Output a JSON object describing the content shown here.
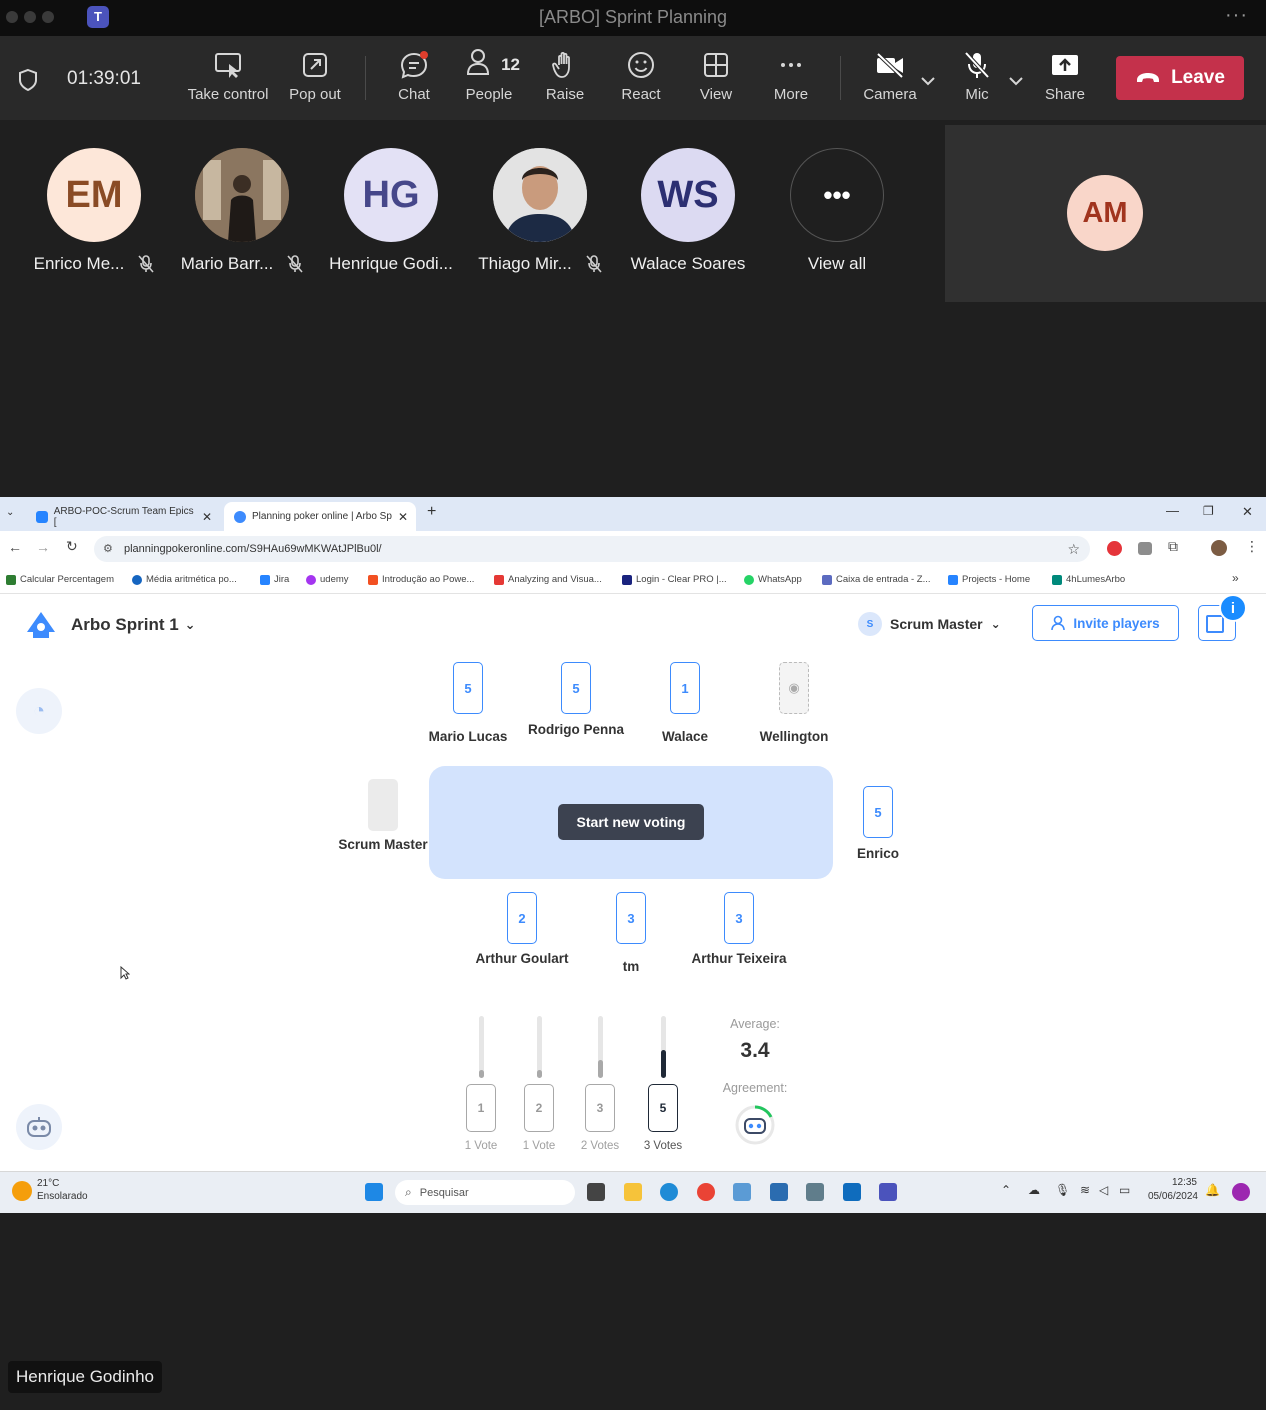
{
  "window": {
    "title": "[ARBO] Sprint Planning"
  },
  "toolbar": {
    "timer": "01:39:01",
    "take_control": "Take control",
    "pop_out": "Pop out",
    "chat": "Chat",
    "people": "People",
    "people_count": "12",
    "raise": "Raise",
    "react": "React",
    "view": "View",
    "more": "More",
    "camera": "Camera",
    "mic": "Mic",
    "share": "Share",
    "leave": "Leave"
  },
  "participants": [
    {
      "initials": "EM",
      "name": "Enrico Me...",
      "muted": true
    },
    {
      "initials": "",
      "name": "Mario Barr...",
      "muted": true
    },
    {
      "initials": "HG",
      "name": "Henrique Godi...",
      "muted": false
    },
    {
      "initials": "",
      "name": "Thiago Mir...",
      "muted": true
    },
    {
      "initials": "WS",
      "name": "Walace Soares",
      "muted": false
    },
    {
      "initials": "",
      "name": "View all",
      "muted": false
    }
  ],
  "self_tile": {
    "initials": "AM"
  },
  "browser": {
    "tabs": [
      {
        "title": "ARBO-POC-Scrum Team Epics [",
        "active": false
      },
      {
        "title": "Planning poker online | Arbo Sp",
        "active": true
      }
    ],
    "url": "planningpokeronline.com/S9HAu69wMKWAtJPlBu0l/",
    "bookmarks": [
      "Calcular Percentagem",
      "Média aritmética po...",
      "Jira",
      "udemy",
      "Introdução ao Powe...",
      "Analyzing and Visua...",
      "Login - Clear PRO |...",
      "WhatsApp",
      "Caixa de entrada - Z...",
      "Projects - Home",
      "4hLumesArbo"
    ]
  },
  "poker": {
    "game_name": "Arbo Sprint 1",
    "role": "Scrum Master",
    "role_badge": "S",
    "invite": "Invite players",
    "start_new_voting": "Start new voting",
    "players_top": [
      {
        "name": "Mario Lucas",
        "vote": "5"
      },
      {
        "name": "Rodrigo Penna",
        "vote": "5"
      },
      {
        "name": "Walace",
        "vote": "1"
      },
      {
        "name": "Wellington",
        "vote": ""
      }
    ],
    "player_left": {
      "name": "Scrum Master",
      "vote": ""
    },
    "player_right": {
      "name": "Enrico",
      "vote": "5"
    },
    "players_bottom": [
      {
        "name": "Arthur Goulart",
        "vote": "2"
      },
      {
        "name": "tm",
        "vote": "3"
      },
      {
        "name": "Arthur Teixeira",
        "vote": "3"
      }
    ],
    "results": [
      {
        "card": "1",
        "label": "1 Vote",
        "votes": 1
      },
      {
        "card": "2",
        "label": "1 Vote",
        "votes": 1
      },
      {
        "card": "3",
        "label": "2 Votes",
        "votes": 2
      },
      {
        "card": "5",
        "label": "3 Votes",
        "votes": 3
      }
    ],
    "average_label": "Average:",
    "average": "3.4",
    "agreement_label": "Agreement:"
  },
  "taskbar": {
    "weather_temp": "21°C",
    "weather_desc": "Ensolarado",
    "search": "Pesquisar",
    "time": "12:35",
    "date": "05/06/2024"
  },
  "speaker_tag": "Henrique Godinho",
  "colors": {
    "leave": "#c4314b",
    "accent": "#3d8bfd",
    "table": "#d3e3fd"
  }
}
